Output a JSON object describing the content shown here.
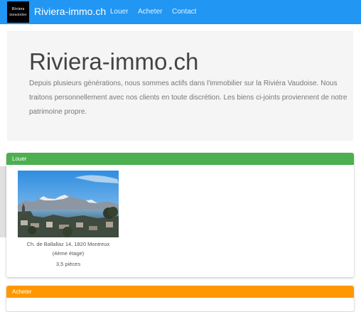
{
  "navbar": {
    "logo_line1": "Riviera",
    "logo_line2": "immobilier",
    "brand": "Riviera-immo.ch",
    "links": [
      {
        "label": "Louer"
      },
      {
        "label": "Acheter"
      },
      {
        "label": "Contact"
      }
    ]
  },
  "jumbotron": {
    "title": "Riviera-immo.ch",
    "text": "Depuis plusieurs générations, nous sommes actifs dans l'immobilier sur la Riviéra Vaudoise. Nous traitons personnellement avec nos clients en toute discrétion. Les biens ci-joints proviennent de notre patrimoine propre."
  },
  "panels": {
    "louer": {
      "heading": "Louer",
      "listings": [
        {
          "address": "Ch. de Ballallaz 14, 1820 Montreux (4ème étage)",
          "rooms": "3,5 pièces"
        }
      ]
    },
    "acheter": {
      "heading": "Acheter"
    }
  },
  "colors": {
    "navbar": "#2196f3",
    "louer": "#4caf50",
    "acheter": "#ff9800"
  }
}
